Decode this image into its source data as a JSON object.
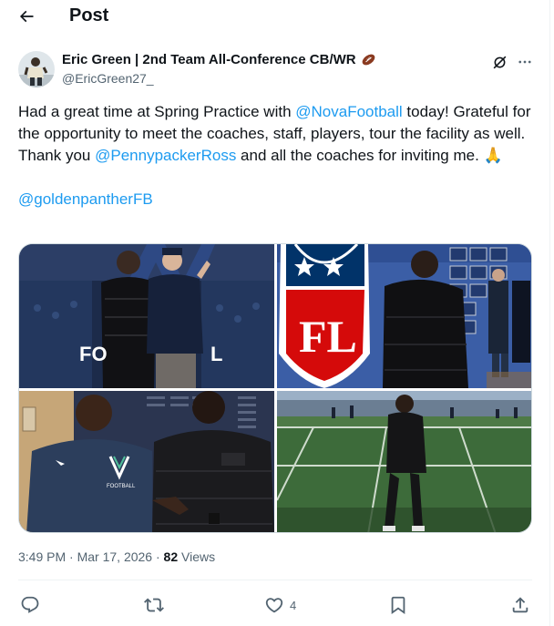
{
  "header": {
    "title": "Post",
    "back_icon": "arrow-left-icon"
  },
  "author": {
    "name": "Eric Green | 2nd Team All-Conference CB/WR",
    "handle": "@EricGreen27_",
    "name_emoji": "football"
  },
  "tweet": {
    "seg1": "Had a great time at Spring Practice with ",
    "mention1": "@NovaFootball",
    "seg2": " today! Grateful for the opportunity to meet the coaches, staff, players, tour the facility as well. Thank you ",
    "mention2": "@PennypackerRoss",
    "seg3": " and all the coaches for inviting me. ",
    "emoji": "🙏",
    "mention3": "@goldenpantherFB"
  },
  "media": {
    "photo1_text_left": "FO",
    "photo1_text_right": "L",
    "photo2_logo_text": "FL"
  },
  "meta": {
    "time": "3:49 PM",
    "sep1": " · ",
    "date": "Mar 17, 2026",
    "sep2": " · ",
    "views_count": "82",
    "views_label": " Views"
  },
  "actions": {
    "reply_count": "",
    "repost_count": "",
    "like_count": "4",
    "bookmark_count": ""
  },
  "colors": {
    "accent": "#1d9bf0",
    "text": "#0f1419",
    "muted": "#536471"
  }
}
